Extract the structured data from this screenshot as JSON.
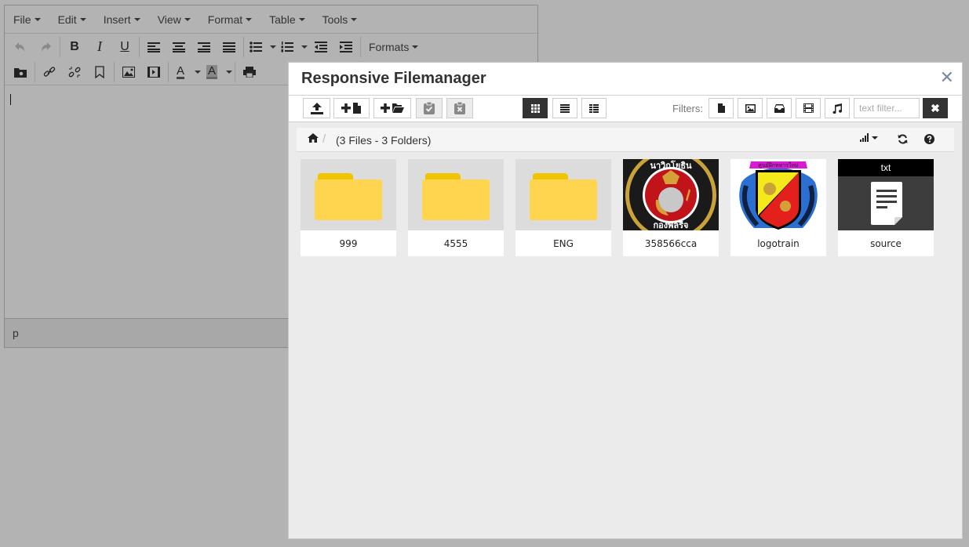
{
  "editor": {
    "menu": [
      {
        "label": "File"
      },
      {
        "label": "Edit"
      },
      {
        "label": "Insert"
      },
      {
        "label": "View"
      },
      {
        "label": "Format"
      },
      {
        "label": "Table"
      },
      {
        "label": "Tools"
      }
    ],
    "formats_label": "Formats",
    "statusbar_path": "p"
  },
  "modal": {
    "title": "Responsive Filemanager",
    "close_symbol": "✕",
    "filters_label": "Filters:",
    "text_filter_placeholder": "text filter...",
    "clear_symbol": "✖",
    "breadcrumb_separator": "/",
    "summary": "(3 Files - 3 Folders)",
    "items": [
      {
        "name": "999",
        "type": "folder"
      },
      {
        "name": "4555",
        "type": "folder"
      },
      {
        "name": "ENG",
        "type": "folder"
      },
      {
        "name": "358566cca",
        "type": "image"
      },
      {
        "name": "logotrain",
        "type": "image"
      },
      {
        "name": "source",
        "type": "file",
        "extension": "txt"
      }
    ]
  },
  "colors": {
    "folder": "#ffd54f",
    "folder_tab": "#f0c400",
    "active_button": "#333333"
  }
}
